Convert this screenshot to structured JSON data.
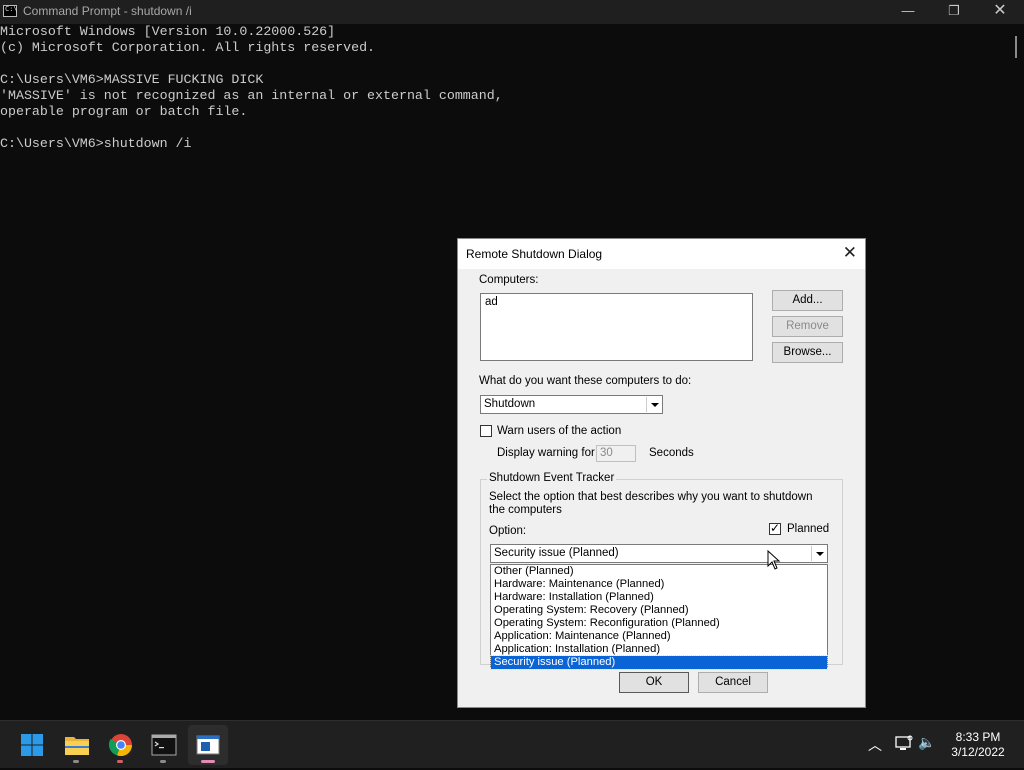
{
  "window": {
    "title": "Command Prompt - shutdown  /i",
    "min_glyph": "—",
    "max_glyph": "❐",
    "close_glyph": "✕"
  },
  "console": {
    "lines": [
      "Microsoft Windows [Version 10.0.22000.526]",
      "(c) Microsoft Corporation. All rights reserved.",
      "",
      "C:\\Users\\VM6>MASSIVE FUCKING DICK",
      "'MASSIVE' is not recognized as an internal or external command,",
      "operable program or batch file.",
      "",
      "C:\\Users\\VM6>shutdown /i"
    ]
  },
  "dialog": {
    "title": "Remote Shutdown Dialog",
    "close_glyph": "✕",
    "computers_label": "Computers:",
    "computers_value": "ad",
    "add_button": "Add...",
    "remove_button": "Remove",
    "browse_button": "Browse...",
    "action_label": "What do you want these computers to do:",
    "action_value": "Shutdown",
    "warn_label": "Warn users of the action",
    "display_warning_label": "Display warning for",
    "warning_seconds": "30",
    "seconds_label": "Seconds",
    "tracker_legend": "Shutdown Event Tracker",
    "tracker_desc": "Select the option that best describes why you want to shutdown the computers",
    "option_label": "Option:",
    "planned_label": "Planned",
    "option_value": "Security issue (Planned)",
    "options": [
      "Other (Planned)",
      "Hardware: Maintenance (Planned)",
      "Hardware: Installation (Planned)",
      "Operating System: Recovery (Planned)",
      "Operating System: Reconfiguration (Planned)",
      "Application: Maintenance (Planned)",
      "Application: Installation (Planned)",
      "Security issue (Planned)"
    ],
    "ok_button": "OK",
    "cancel_button": "Cancel"
  },
  "taskbar": {
    "time": "8:33 PM",
    "date": "3/12/2022",
    "chevron_glyph": "︿",
    "volume_glyph": "🔈"
  },
  "colors": {
    "selection": "#0a64d6",
    "console_bg": "#0c0c0c",
    "taskbar_bg": "#202020"
  }
}
